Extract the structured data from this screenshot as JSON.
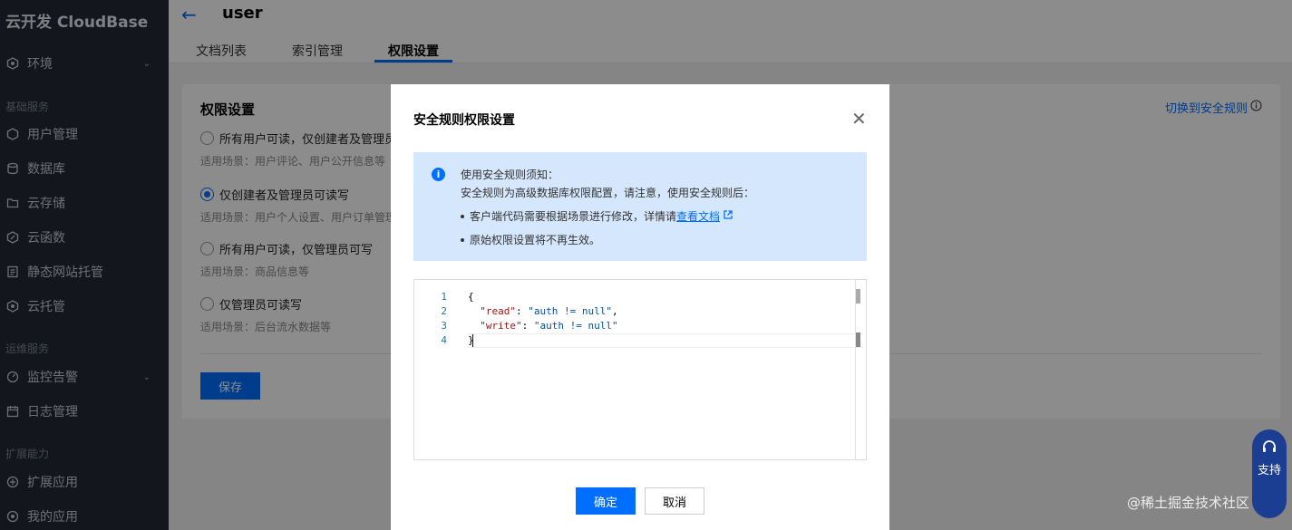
{
  "brand": "云开发 CloudBase",
  "sidebar": {
    "env": "环境",
    "section_basic": "基础服务",
    "items_basic": [
      "用户管理",
      "数据库",
      "云存储",
      "云函数",
      "静态网站托管",
      "云托管"
    ],
    "section_ops": "运维服务",
    "items_ops": [
      "监控告警",
      "日志管理"
    ],
    "section_ext": "扩展能力",
    "items_ext": [
      "扩展应用",
      "我的应用"
    ]
  },
  "header": {
    "title": "user",
    "tabs": [
      "文档列表",
      "索引管理",
      "权限设置"
    ],
    "active_tab": "权限设置"
  },
  "permissions": {
    "title": "权限设置",
    "switch_link": "切换到安全规则",
    "options": [
      {
        "label": "所有用户可读，仅创建者及管理员可",
        "hint": "适用场景：用户评论、用户公开信息等",
        "checked": false
      },
      {
        "label": "仅创建者及管理员可读写",
        "hint": "适用场景：用户个人设置、用户订单管理",
        "checked": true
      },
      {
        "label": "所有用户可读，仅管理员可写",
        "hint": "适用场景：商品信息等",
        "checked": false
      },
      {
        "label": "仅管理员可读写",
        "hint": "适用场景：后台流水数据等",
        "checked": false
      }
    ],
    "save_label": "保存"
  },
  "modal": {
    "title": "安全规则权限设置",
    "notice": {
      "line1": "使用安全规则须知：",
      "line2": "安全规则为高级数据库权限配置，请注意，使用安全规则后：",
      "bullet1_prefix": "客户端代码需要根据场景进行修改，详情请",
      "bullet1_link": "查看文档",
      "bullet2": "原始权限设置将不再生效。"
    },
    "code_lines": [
      "{",
      "  \"read\": \"auth != null\",",
      "  \"write\": \"auth != null\"",
      "}"
    ],
    "line_numbers": [
      "1",
      "2",
      "3",
      "4"
    ],
    "ok_label": "确定",
    "cancel_label": "取消"
  },
  "support": {
    "label": "支持"
  },
  "watermark": "@稀土掘金技术社区"
}
